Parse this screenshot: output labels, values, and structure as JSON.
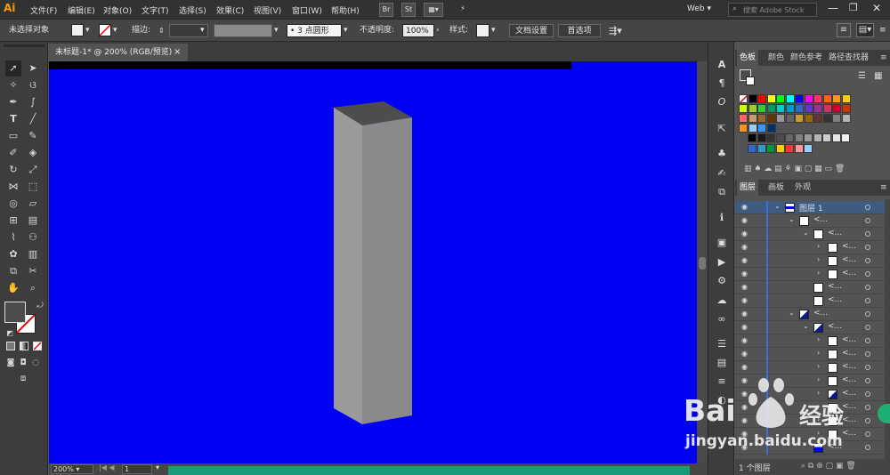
{
  "app": {
    "logo": "Ai"
  },
  "menu": [
    "文件(F)",
    "编辑(E)",
    "对象(O)",
    "文字(T)",
    "选择(S)",
    "效果(C)",
    "视图(V)",
    "窗口(W)",
    "帮助(H)"
  ],
  "menubar_icons": {
    "bridge": "Br",
    "stock": "St"
  },
  "workspace": {
    "label": "Web",
    "search_placeholder": "搜索 Adobe Stock"
  },
  "control": {
    "selection_status": "未选择对象",
    "stroke_label": "描边:",
    "brush_value": "3 点圆形",
    "opacity_label": "不透明度:",
    "opacity_value": "100%",
    "style_label": "样式:",
    "doc_setup_button": "文档设置",
    "prefs_button": "首选项"
  },
  "document": {
    "tab_title": "未标题-1* @ 200% (RGB/预览)",
    "close_glyph": "×",
    "canvas_color": "#0000f5"
  },
  "status": {
    "zoom": "200%",
    "artboard": "1"
  },
  "swatches_panel": {
    "tabs": [
      "色板",
      "颜色",
      "颜色参考",
      "路径查找器"
    ],
    "rows": [
      [
        "#ffffff",
        "#000000",
        "#ff0000",
        "#ffff00",
        "#00ff00",
        "#00ffff",
        "#0000ff",
        "#ff00ff",
        "#ff3366",
        "#ff6600",
        "#ff9900",
        "#ffcc00"
      ],
      [
        "#ccff00",
        "#99cc33",
        "#33cc33",
        "#009966",
        "#00cccc",
        "#0099cc",
        "#3366cc",
        "#6633cc",
        "#993399",
        "#cc3366",
        "#cc0033",
        "#cc3300"
      ],
      [
        "#ff6666",
        "#cc9966",
        "#996633",
        "#663300",
        "#999999",
        "#666666",
        "#cc9933",
        "#996600",
        "#663333",
        "#333333",
        "#808080",
        "#b3b3b3"
      ],
      [
        "#f7941d",
        "#99ccff",
        "#3399ff",
        "#003366"
      ],
      [
        "#000000",
        "#1a1a1a",
        "#333333",
        "#4d4d4d",
        "#666666",
        "#808080",
        "#999999",
        "#b3b3b3",
        "#cccccc",
        "#e6e6e6",
        "#f2f2f2"
      ],
      [
        "#3366cc",
        "#3399cc",
        "#009933",
        "#ffcc00",
        "#ff3333",
        "#ff9999",
        "#99ccff"
      ]
    ]
  },
  "layers_panel": {
    "tabs": [
      "图层",
      "画板",
      "外观"
    ],
    "top_layer_name": "图层 1",
    "sublayer_label": "<...",
    "footer_count": "1 个图层"
  },
  "watermark": {
    "brand": "Bai",
    "sub": "jingyan.baidu.com",
    "cn": "经验"
  }
}
